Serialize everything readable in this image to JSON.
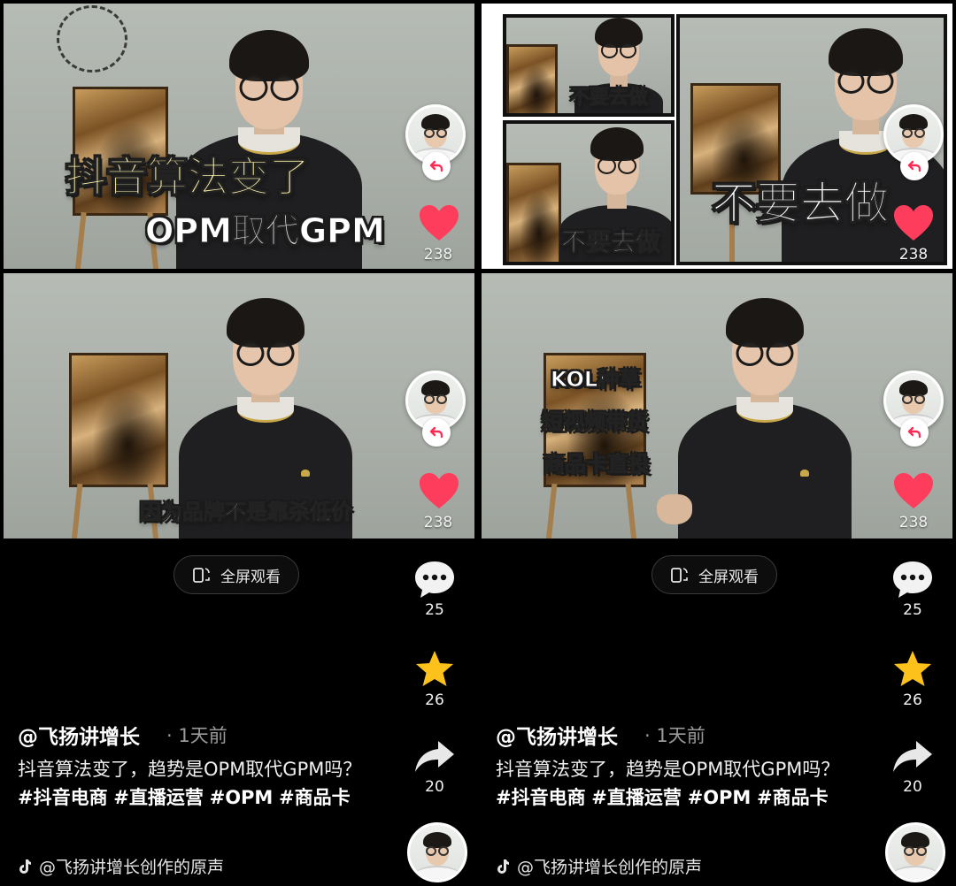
{
  "frames": [
    {
      "captions": [
        "抖音算法变了",
        "OPM取代GPM"
      ],
      "like_count": "238"
    },
    {
      "captions": [
        "不要去做",
        "不要去做",
        "不要去做"
      ],
      "like_count": "238"
    },
    {
      "captions": [
        "因为品牌不是靠杀低价"
      ],
      "like_count": "238"
    },
    {
      "captions": [
        "KOL种草",
        "短视频带货",
        "商品卡直投"
      ],
      "like_count": "238"
    }
  ],
  "posts": [
    {
      "fullscreen_label": "全屏观看",
      "comment_count": "25",
      "favorite_count": "26",
      "share_count": "20",
      "author": "@飞扬讲增长",
      "time": "· 1天前",
      "desc_text": "抖音算法变了，趋势是OPM取代GPM吗？",
      "hashtags": [
        "#抖音电商",
        "#直播运营",
        "#OPM",
        "#商品卡"
      ],
      "music": "@飞扬讲增长创作的原声"
    },
    {
      "fullscreen_label": "全屏观看",
      "comment_count": "25",
      "favorite_count": "26",
      "share_count": "20",
      "author": "@飞扬讲增长",
      "time": "· 1天前",
      "desc_text": "抖音算法变了，趋势是OPM取代GPM吗？",
      "hashtags": [
        "#抖音电商",
        "#直播运营",
        "#OPM",
        "#商品卡"
      ],
      "music": "@飞扬讲增长创作的原声"
    }
  ],
  "icons": {
    "like": "heart-icon",
    "comment": "comment-bubble-icon",
    "favorite": "star-icon",
    "share": "share-arrow-icon",
    "follow": "follow-return-icon",
    "fullscreen": "fullscreen-rotate-icon",
    "music": "tiktok-note-icon"
  },
  "colors": {
    "like": "#fe3d5c",
    "favorite": "#fcc21b",
    "background": "#000000",
    "caption_yellow": "#fff3a8",
    "follow_accent": "#fe2c55"
  }
}
